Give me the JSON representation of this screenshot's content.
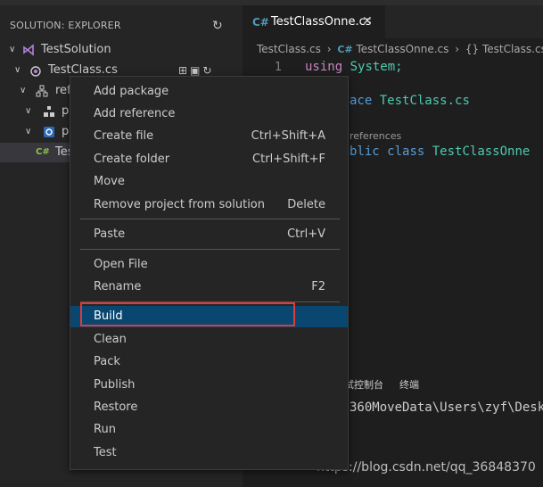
{
  "sidebar": {
    "header": "SOLUTION: EXPLORER",
    "tree": {
      "solution": "TestSolution",
      "project": "TestClass.cs",
      "references": "ref",
      "pkg1": "p",
      "pkg2": "p",
      "file": "Tes"
    }
  },
  "editor": {
    "tab": {
      "label": "TestClassOnne.cs",
      "icon": "C#"
    },
    "breadcrumb": [
      "TestClass.cs",
      "TestClassOnne.cs",
      "TestClass.cs"
    ],
    "line_number": "1",
    "code": {
      "line1_kw": "using",
      "line1_rest": "System;",
      "line2_kw": "ace",
      "line2_name": "TestClass.cs",
      "codelens": "references",
      "line3_kw1": "blic",
      "line3_kw2": "class",
      "line3_name": "TestClassOnne"
    },
    "panel_tabs": [
      "试控制台",
      "终端"
    ],
    "terminal_text": "360MoveData\\Users\\zyf\\Desk"
  },
  "context_menu": {
    "items": [
      {
        "label": "Add package",
        "shortcut": ""
      },
      {
        "label": "Add reference",
        "shortcut": ""
      },
      {
        "label": "Create file",
        "shortcut": "Ctrl+Shift+A"
      },
      {
        "label": "Create folder",
        "shortcut": "Ctrl+Shift+F"
      },
      {
        "label": "Move",
        "shortcut": ""
      },
      {
        "label": "Remove project from solution",
        "shortcut": "Delete"
      },
      {
        "label": "Paste",
        "shortcut": "Ctrl+V"
      },
      {
        "label": "Open File",
        "shortcut": ""
      },
      {
        "label": "Rename",
        "shortcut": "F2"
      },
      {
        "label": "Build",
        "shortcut": ""
      },
      {
        "label": "Clean",
        "shortcut": ""
      },
      {
        "label": "Pack",
        "shortcut": ""
      },
      {
        "label": "Publish",
        "shortcut": ""
      },
      {
        "label": "Restore",
        "shortcut": ""
      },
      {
        "label": "Run",
        "shortcut": ""
      },
      {
        "label": "Test",
        "shortcut": ""
      }
    ]
  },
  "watermark": "https://blog.csdn.net/qq_36848370",
  "colors": {
    "menu_active": "#094771",
    "highlight_box": "#e03b3b",
    "csharp_icon": "#519aba"
  }
}
